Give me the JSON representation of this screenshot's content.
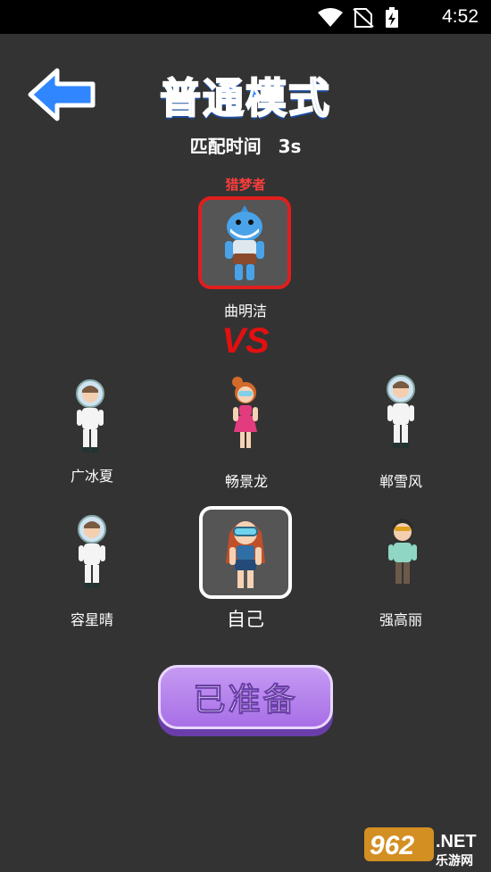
{
  "status_bar": {
    "time": "4:52"
  },
  "header": {
    "title": "普通模式"
  },
  "match": {
    "label": "匹配时间",
    "seconds": "3s"
  },
  "opponent": {
    "role_label": "猎梦者",
    "name": "曲明洁"
  },
  "vs_text": "VS",
  "players": [
    {
      "name": "广冰夏"
    },
    {
      "name": "畅景龙"
    },
    {
      "name": "郸雪风"
    },
    {
      "name": "容星晴"
    },
    {
      "name": "自己"
    },
    {
      "name": "强高丽"
    }
  ],
  "ready_button": {
    "label": "已准备"
  },
  "watermark": {
    "brand": "962.NET",
    "subtitle": "乐游网"
  },
  "colors": {
    "background": "#333333",
    "title_blue": "#2f86ff",
    "hunter_red": "#e01e1e",
    "ready_purple": "#a86fe6"
  }
}
